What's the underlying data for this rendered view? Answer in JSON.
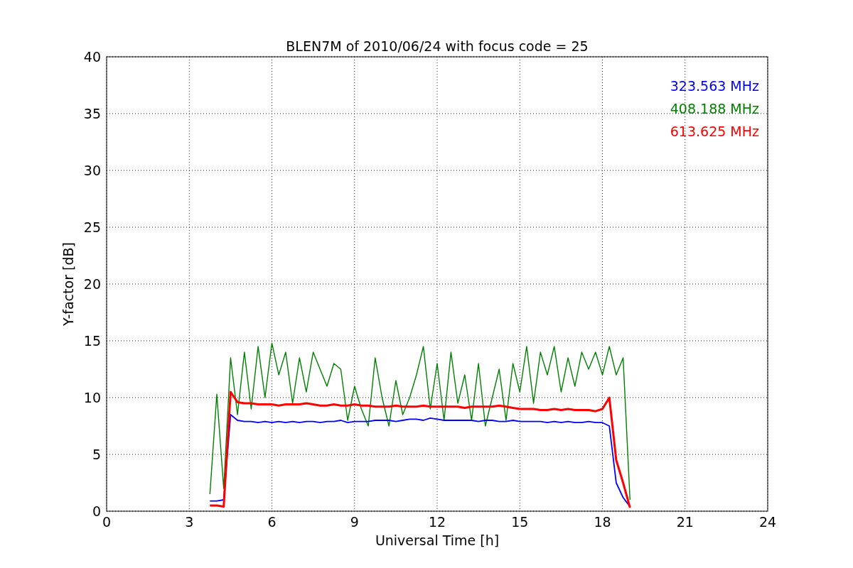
{
  "chart_data": {
    "type": "line",
    "title": "BLEN7M of 2010/06/24 with focus code = 25",
    "xlabel": "Universal Time [h]",
    "ylabel": "Y-factor [dB]",
    "xlim": [
      0,
      24
    ],
    "ylim": [
      0,
      40
    ],
    "xticks": [
      0,
      3,
      6,
      9,
      12,
      15,
      18,
      21,
      24
    ],
    "yticks": [
      0,
      5,
      10,
      15,
      20,
      25,
      30,
      35,
      40
    ],
    "grid": true,
    "x": [
      3.75,
      4,
      4.25,
      4.5,
      4.75,
      5,
      5.25,
      5.5,
      5.75,
      6,
      6.25,
      6.5,
      6.75,
      7,
      7.25,
      7.5,
      7.75,
      8,
      8.25,
      8.5,
      8.75,
      9,
      9.25,
      9.5,
      9.75,
      10,
      10.25,
      10.5,
      10.75,
      11,
      11.25,
      11.5,
      11.75,
      12,
      12.25,
      12.5,
      12.75,
      13,
      13.25,
      13.5,
      13.75,
      14,
      14.25,
      14.5,
      14.75,
      15,
      15.25,
      15.5,
      15.75,
      16,
      16.25,
      16.5,
      16.75,
      17,
      17.25,
      17.5,
      17.75,
      18,
      18.25,
      18.5,
      18.75,
      19
    ],
    "series": [
      {
        "name": "323.563 MHz",
        "color": "#0000ff",
        "values": [
          0.9,
          0.9,
          1.0,
          8.5,
          8.0,
          7.9,
          7.9,
          7.8,
          7.9,
          7.8,
          7.9,
          7.8,
          7.9,
          7.8,
          7.9,
          7.9,
          7.8,
          7.9,
          7.9,
          8.0,
          7.8,
          7.9,
          7.9,
          7.9,
          8.0,
          8.0,
          8.0,
          7.9,
          8.0,
          8.1,
          8.1,
          8.0,
          8.2,
          8.1,
          8.0,
          8.0,
          8.0,
          8.0,
          8.0,
          7.9,
          8.0,
          8.0,
          7.9,
          7.9,
          8.0,
          7.9,
          7.9,
          7.9,
          7.9,
          7.8,
          7.9,
          7.8,
          7.9,
          7.8,
          7.8,
          7.9,
          7.8,
          7.8,
          7.5,
          2.5,
          1.2,
          0.4
        ]
      },
      {
        "name": "408.188 MHz",
        "color": "#008000",
        "values": [
          1.5,
          10.3,
          2.0,
          13.5,
          8.5,
          14.0,
          9.0,
          14.5,
          10.0,
          14.8,
          12.0,
          14.0,
          9.5,
          13.5,
          10.5,
          14.0,
          12.5,
          11.0,
          13.0,
          12.5,
          8.0,
          11.0,
          9.0,
          7.5,
          13.5,
          10.0,
          7.5,
          11.5,
          8.5,
          10.0,
          12.0,
          14.5,
          9.0,
          13.0,
          8.0,
          14.0,
          9.5,
          12.0,
          8.0,
          13.0,
          7.5,
          10.0,
          12.5,
          8.0,
          13.0,
          10.5,
          14.5,
          9.5,
          14.0,
          12.0,
          14.5,
          10.5,
          13.5,
          11.0,
          14.0,
          12.5,
          14.0,
          12.0,
          14.5,
          12.0,
          13.5,
          1.0
        ]
      },
      {
        "name": "613.625 MHz",
        "color": "#ff0000",
        "values": [
          0.5,
          0.5,
          0.4,
          10.5,
          9.6,
          9.5,
          9.5,
          9.4,
          9.4,
          9.4,
          9.3,
          9.4,
          9.4,
          9.4,
          9.5,
          9.4,
          9.3,
          9.3,
          9.4,
          9.3,
          9.3,
          9.4,
          9.3,
          9.3,
          9.2,
          9.2,
          9.2,
          9.3,
          9.2,
          9.2,
          9.2,
          9.3,
          9.2,
          9.2,
          9.2,
          9.2,
          9.2,
          9.1,
          9.2,
          9.2,
          9.2,
          9.2,
          9.3,
          9.2,
          9.1,
          9.0,
          9.0,
          9.0,
          8.9,
          8.9,
          9.0,
          8.9,
          9.0,
          8.9,
          8.9,
          8.9,
          8.8,
          9.0,
          10.0,
          4.5,
          2.5,
          0.3
        ]
      }
    ]
  }
}
